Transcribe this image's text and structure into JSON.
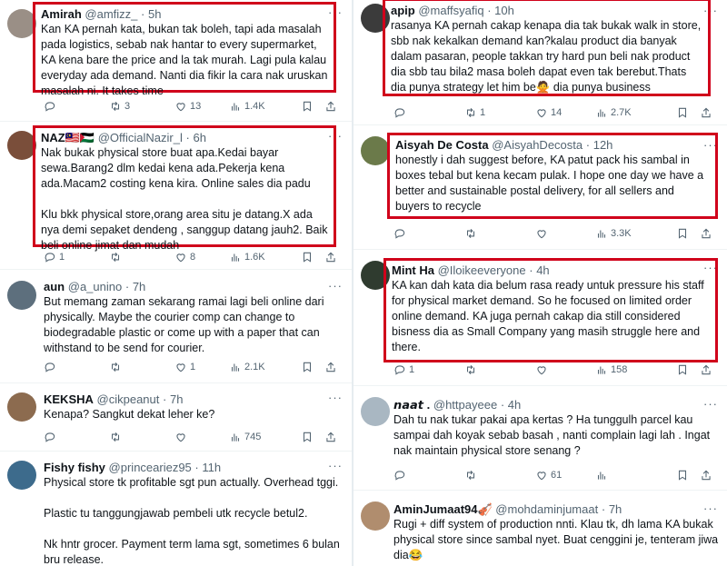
{
  "left": [
    {
      "name": "Amirah",
      "handle": "@amfizz_",
      "time": "5h",
      "text": "Kan KA pernah kata, bukan tak boleh, tapi ada masalah pada logistics, sebab nak hantar to every supermarket, KA kena bare the price and la tak murah. Lagi pula kalau everyday ada demand. Nanti dia fikir la cara nak uruskan masalah ni. It takes time",
      "replies": "",
      "retweets": "3",
      "likes": "13",
      "views": "1.4K",
      "avatar_color": "#9a8f86"
    },
    {
      "name": "NAZ🇲🇾🇵🇸",
      "handle": "@OfficialNazir_l",
      "time": "6h",
      "text": "Nak bukak physical store buat apa.Kedai bayar sewa.Barang2 dlm kedai kena ada.Pekerja kena ada.Macam2 costing kena kira. Online sales dia padu\n\nKlu bkk physical store,orang area situ je datang.X ada nya demi sepaket dendeng , sanggup datang jauh2. Baik beli online jimat dan mudah",
      "replies": "1",
      "retweets": "",
      "likes": "8",
      "views": "1.6K",
      "avatar_color": "#7a4e3a"
    },
    {
      "name": "aun",
      "handle": "@a_unino",
      "time": "7h",
      "text": "But memang zaman sekarang ramai lagi beli online dari physically. Maybe the courier comp can change to biodegradable plastic or come up with a paper that can withstand to be send for courier.",
      "replies": "",
      "retweets": "",
      "likes": "1",
      "views": "2.1K",
      "avatar_color": "#5d6f7d"
    },
    {
      "name": "KEKSHA",
      "handle": "@cikpeanut",
      "time": "7h",
      "text": "Kenapa? Sangkut dekat leher ke?",
      "replies": "",
      "retweets": "",
      "likes": "",
      "views": "745",
      "avatar_color": "#8c6b4f"
    },
    {
      "name": "Fishy fishy",
      "handle": "@princeariez95",
      "time": "11h",
      "text": "Physical store tk profitable sgt pun actually. Overhead tggi.\n\nPlastic tu tanggungjawab pembeli utk recycle betul2.\n\nNk hntr grocer. Payment term lama sgt, sometimes 6 bulan bru release.",
      "replies": "",
      "retweets": "",
      "likes": "",
      "views": "",
      "avatar_color": "#3d6b8c"
    }
  ],
  "right": [
    {
      "name": "apip",
      "handle": "@maffsyafiq",
      "time": "10h",
      "text": "rasanya KA pernah cakap kenapa dia tak bukak walk in store, sbb nak kekalkan demand kan?kalau product dia banyak dalam pasaran, people takkan try hard pun beli nak product dia sbb tau bila2 masa boleh dapat even tak berebut.Thats dia punya strategy let him be🙅 dia punya business",
      "replies": "",
      "retweets": "1",
      "likes": "14",
      "views": "2.7K",
      "avatar_color": "#3b3b3b"
    },
    {
      "name": "Aisyah De Costa",
      "handle": "@AisyahDecosta",
      "time": "12h",
      "text": "honestly i dah suggest before, KA patut pack his sambal in boxes tebal but kena kecam pulak. I hope one day we have a better and sustainable postal delivery, for all sellers and buyers to recycle",
      "replies": "",
      "retweets": "",
      "likes": "",
      "views": "3.3K",
      "avatar_color": "#6b7a4a"
    },
    {
      "name": "Mint Ha",
      "handle": "@Iloikeeveryone",
      "time": "4h",
      "text": "KA kan dah kata dia belum rasa ready untuk pressure his staff for physical market demand. So he focused on limited order online demand. KA juga pernah cakap dia still considered bisness dia as Small Company yang masih struggle here and there.",
      "replies": "1",
      "retweets": "",
      "likes": "",
      "views": "158",
      "avatar_color": "#2f3b2f"
    },
    {
      "name": "𝙣𝙖𝙖𝙩 .",
      "handle": "@httpayeee",
      "time": "4h",
      "text": "Dah tu nak tukar pakai apa kertas ? Ha tunggulh parcel kau sampai dah koyak sebab basah , nanti complain lagi lah . Ingat nak maintain physical store senang ?",
      "replies": "",
      "retweets": "",
      "likes": "61",
      "views": "",
      "avatar_color": "#a9b7c2"
    },
    {
      "name": "AminJumaat94🎻",
      "handle": "@mohdaminjumaat",
      "time": "7h",
      "text": "Rugi + diff system of production nnti. Klau tk, dh lama KA bukak physical store since sambal nyet. Buat cenggini je, tenteram jiwa dia😂",
      "replies": "",
      "retweets": "",
      "likes": "",
      "views": "",
      "avatar_color": "#b08d6e"
    }
  ],
  "colors": {
    "highlight": "#d0021b",
    "muted": "#536471",
    "divider": "#eff3f4"
  },
  "icons": [
    "more-icon",
    "reply-icon",
    "retweet-icon",
    "like-icon",
    "views-icon",
    "bookmark-icon",
    "share-icon"
  ]
}
